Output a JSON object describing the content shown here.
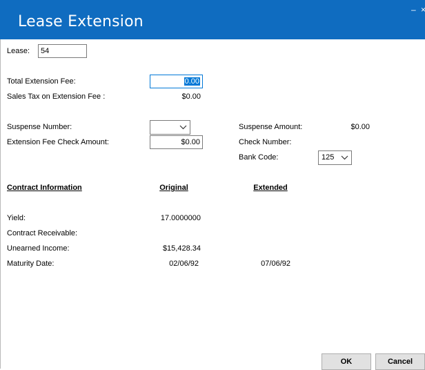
{
  "window": {
    "title": "Lease Extension"
  },
  "lease": {
    "label": "Lease:",
    "value": "54"
  },
  "fees": {
    "total_label": "Total Extension Fee:",
    "total_value": "0.00",
    "sales_tax_label": "Sales Tax on Extension Fee  :",
    "sales_tax_value": "$0.00"
  },
  "suspense": {
    "number_label": "Suspense Number:",
    "number_value": "",
    "check_amount_label": "Extension Fee Check Amount:",
    "check_amount_value": "$0.00",
    "amount_label": "Suspense Amount:",
    "amount_value": "$0.00",
    "check_number_label": "Check Number:",
    "check_number_value": "",
    "bank_code_label": "Bank Code:",
    "bank_code_value": "125"
  },
  "contract": {
    "header_info": "Contract Information",
    "header_original": "Original",
    "header_extended": "Extended",
    "rows": [
      {
        "label": "Yield:",
        "original": "17.0000000",
        "extended": ""
      },
      {
        "label": "Contract Receivable:",
        "original": "",
        "extended": ""
      },
      {
        "label": "Unearned Income:",
        "original": "$15,428.34",
        "extended": ""
      },
      {
        "label": "Maturity Date:",
        "original": "02/06/92",
        "extended": "07/06/92"
      }
    ]
  },
  "buttons": {
    "ok": "OK",
    "cancel": "Cancel"
  },
  "colors": {
    "titlebar": "#0f6cc0",
    "selection": "#0078d7"
  }
}
